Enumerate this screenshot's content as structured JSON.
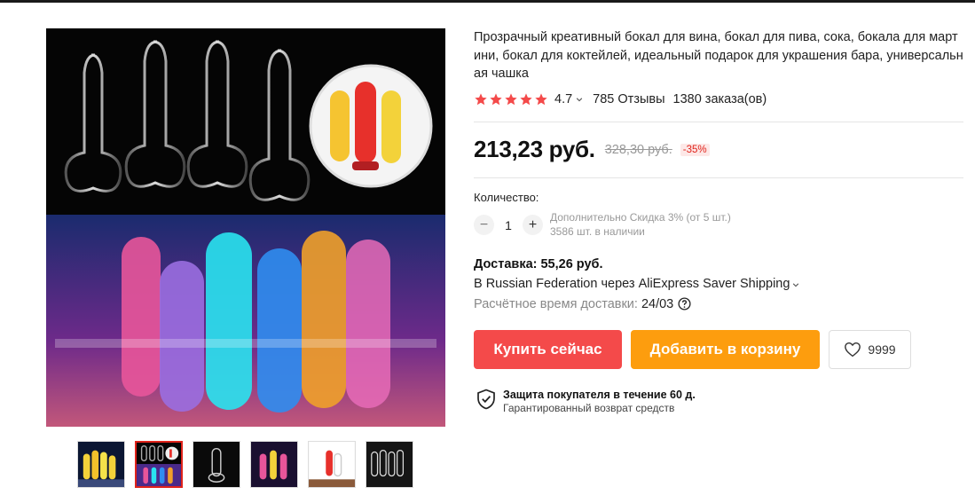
{
  "product": {
    "title": "Прозрачный креативный бокал для вина, бокал для пива, сока, бокала для мартини, бокал для коктейлей, идеальный подарок для украшения бара, универсальная чашка",
    "rating": "4.7",
    "rating_stars": 5,
    "reviews": "785 Отзывы",
    "orders": "1380 заказа(ов)"
  },
  "price": {
    "current": "213,23 руб.",
    "old": "328,30 руб.",
    "discount": "-35%"
  },
  "quantity": {
    "label": "Количество:",
    "minus": "−",
    "value": "1",
    "plus": "+",
    "extra_discount": "Дополнительно Скидка 3% (от 5 шт.)",
    "stock": "3586 шт. в наличии"
  },
  "shipping": {
    "title": "Доставка: 55,26 руб.",
    "method": "В Russian Federation через AliExpress Saver Shipping",
    "eta_label": "Расчётное время доставки:",
    "eta_value": "24/03"
  },
  "actions": {
    "buy_now": "Купить сейчас",
    "add_to_cart": "Добавить в корзину",
    "wishlist_count": "9999"
  },
  "protection": {
    "title": "Защита покупателя в течение 60 д.",
    "subtitle": "Гарантированный возврат средств"
  },
  "gallery": {
    "thumbnail_count": 6,
    "active_index": 1
  },
  "colors": {
    "star": "#f44a4a",
    "buy": "#f44a4a",
    "cart": "#fd9d0e",
    "discount": "#e0231b",
    "active_thumb_border": "#e0231b"
  }
}
